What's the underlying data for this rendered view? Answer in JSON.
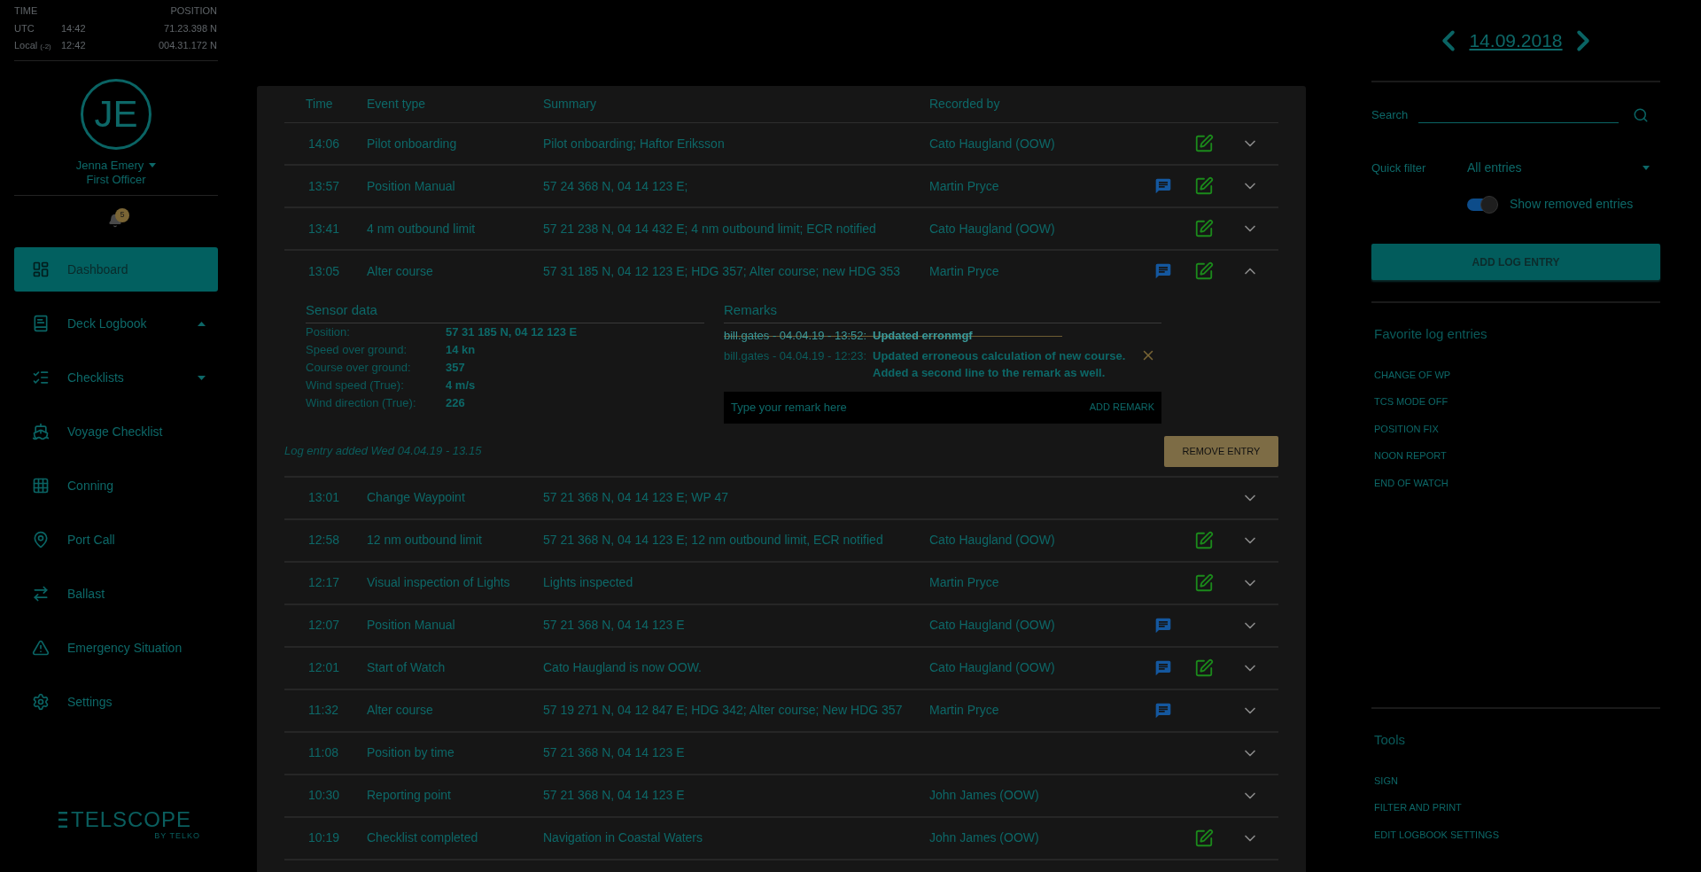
{
  "clock": {
    "time_label": "TIME",
    "position_label": "POSITION",
    "rows": [
      {
        "label": "UTC",
        "offset": "",
        "time": "14:42",
        "position": "71.23.398 N"
      },
      {
        "label": "Local",
        "offset": "(-2)",
        "time": "12:42",
        "position": "004.31.172 N"
      }
    ]
  },
  "user": {
    "initials": "JE",
    "name": "Jenna Emery",
    "role": "First Officer"
  },
  "notifications": {
    "count": "5"
  },
  "nav": [
    {
      "label": "Dashboard",
      "selected": true
    },
    {
      "label": "Deck Logbook",
      "selected": false,
      "expanded": true
    },
    {
      "label": "Checklists",
      "selected": false,
      "expanded": false
    },
    {
      "label": "Voyage Checklist",
      "selected": false
    },
    {
      "label": "Conning",
      "selected": false
    },
    {
      "label": "Port Call",
      "selected": false
    },
    {
      "label": "Ballast",
      "selected": false
    },
    {
      "label": "Emergency Situation",
      "selected": false
    },
    {
      "label": "Settings",
      "selected": false
    }
  ],
  "logo": {
    "name": "TELSCOPE",
    "tagline": "BY TELKO"
  },
  "table": {
    "columns": [
      "Time",
      "Event type",
      "Summary",
      "Recorded by"
    ],
    "rows": [
      {
        "time": "14:06",
        "event_type": "Pilot onboarding",
        "summary": "Pilot onboarding; Haftor Eriksson",
        "recorded_by": "Cato Haugland (OOW)",
        "remarks": false,
        "edited": true,
        "expanded": false
      },
      {
        "time": "13:57",
        "event_type": "Position Manual",
        "summary": "57 24 368 N, 04 14 123 E;",
        "recorded_by": "Martin Pryce",
        "remarks": true,
        "edited": true,
        "expanded": false
      },
      {
        "time": "13:41",
        "event_type": "4 nm outbound limit",
        "summary": "57 21 238 N, 04 14 432 E; 4 nm outbound limit; ECR notified",
        "recorded_by": "Cato Haugland (OOW)",
        "remarks": false,
        "edited": true,
        "expanded": false
      },
      {
        "time": "13:05",
        "event_type": "Alter course",
        "summary": "57 31 185 N, 04 12 123 E; HDG 357; Alter course; new HDG 353",
        "recorded_by": "Martin Pryce",
        "remarks": true,
        "edited": true,
        "expanded": true
      },
      {
        "time": "13:01",
        "event_type": "Change Waypoint",
        "summary": "57 21 368 N, 04 14 123 E; WP 47",
        "remarks": false,
        "edited": false,
        "expanded": false
      },
      {
        "time": "12:58",
        "event_type": "12 nm outbound limit",
        "summary": "57 21 368 N, 04 14 123 E; 12 nm outbound limit, ECR notified",
        "recorded_by": "Cato Haugland (OOW)",
        "remarks": false,
        "edited": true,
        "expanded": false
      },
      {
        "time": "12:17",
        "event_type": "Visual inspection of Lights",
        "summary": "Lights inspected",
        "recorded_by": "Martin Pryce",
        "remarks": false,
        "edited": true,
        "expanded": false
      },
      {
        "time": "12:07",
        "event_type": "Position Manual",
        "summary": "57 21 368 N, 04 14 123 E",
        "recorded_by": "Cato Haugland (OOW)",
        "remarks": true,
        "edited": false,
        "expanded": false
      },
      {
        "time": "12:01",
        "event_type": "Start of Watch",
        "summary": "Cato Haugland is now OOW.",
        "recorded_by": "Cato Haugland (OOW)",
        "remarks": true,
        "edited": true,
        "expanded": false
      },
      {
        "time": "11:32",
        "event_type": "Alter course",
        "summary": "57 19 271 N, 04 12 847 E; HDG 342; Alter course; New HDG 357",
        "recorded_by": "Martin Pryce",
        "remarks": true,
        "edited": false,
        "expanded": false
      },
      {
        "time": "11:08",
        "event_type": "Position by time",
        "summary": "57 21 368 N, 04 14 123 E",
        "remarks": false,
        "edited": false,
        "expanded": false
      },
      {
        "time": "10:30",
        "event_type": "Reporting point",
        "summary": "57 21 368 N, 04 14 123 E",
        "recorded_by": "John James (OOW)",
        "remarks": false,
        "edited": false,
        "expanded": false
      },
      {
        "time": "10:19",
        "event_type": "Checklist completed",
        "summary": "Navigation in Coastal Waters",
        "recorded_by": "John James (OOW)",
        "remarks": false,
        "edited": true,
        "expanded": false
      }
    ]
  },
  "detail": {
    "sensor_title": "Sensor data",
    "sensors": [
      {
        "label": "Position:",
        "value": "57 31 185 N, 04 12 123 E"
      },
      {
        "label": "Speed over ground:",
        "value": "14 kn"
      },
      {
        "label": "Course over ground:",
        "value": "357"
      },
      {
        "label": "Wind speed (True):",
        "value": "4 m/s"
      },
      {
        "label": "Wind direction (True):",
        "value": "226"
      }
    ],
    "remarks_title": "Remarks",
    "remarks": [
      {
        "author": "bill.gates - 04.04.19 - 13:52:",
        "lines": [
          "Updated erronmgf"
        ],
        "removed": true
      },
      {
        "author": "bill.gates - 04.04.19 - 12:23:",
        "lines": [
          "Updated erroneous calculation of new course.",
          "Added a second line to the remark as well."
        ],
        "removed": false
      }
    ],
    "remark_placeholder": "Type your remark here",
    "add_remark": "ADD REMARK",
    "added": "Log entry added Wed 04.04.19 - 13.15",
    "remove": "REMOVE ENTRY"
  },
  "date": "14.09.2018",
  "search": {
    "label": "Search"
  },
  "quick_filter": {
    "label": "Quick filter",
    "value": "All entries"
  },
  "show_removed": {
    "label": "Show removed entries",
    "on": true
  },
  "add_entry": "ADD LOG ENTRY",
  "favorites": {
    "title": "Favorite log entries",
    "items": [
      "CHANGE OF WP",
      "TCS MODE OFF",
      "POSITION FIX",
      "NOON REPORT",
      "END OF WATCH"
    ]
  },
  "tools": {
    "title": "Tools",
    "items": [
      "SIGN",
      "FILTER AND PRINT",
      "EDIT LOGBOOK SETTINGS"
    ]
  }
}
